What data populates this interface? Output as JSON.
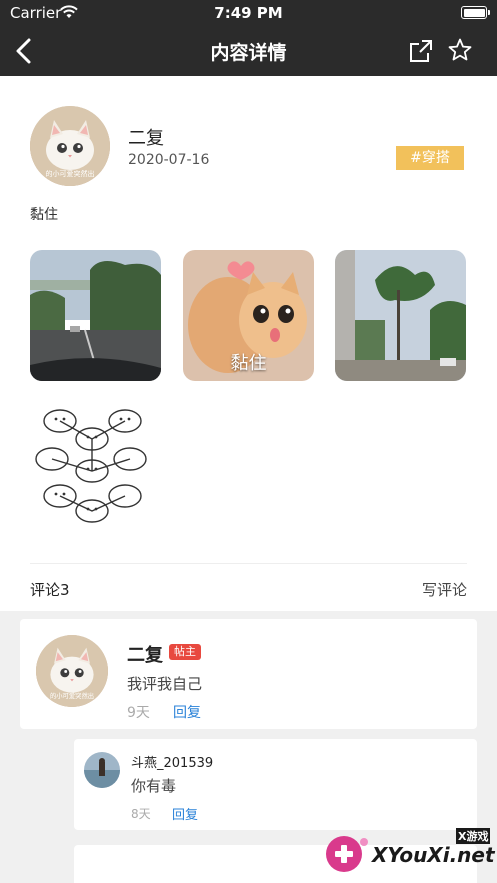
{
  "status_bar": {
    "carrier": "Carrier",
    "time": "7:49 PM"
  },
  "nav": {
    "title": "内容详情"
  },
  "post": {
    "author_name": "二复",
    "date": "2020-07-16",
    "tag": "#穿搭",
    "text": "黏住",
    "avatar_caption": "的小可爱突然出",
    "photos": [
      {
        "name": "street-photo",
        "caption": ""
      },
      {
        "name": "cats-photo",
        "caption": "黏住"
      },
      {
        "name": "trees-photo",
        "caption": ""
      },
      {
        "name": "sketch-photo",
        "caption": ""
      }
    ]
  },
  "comments_header": {
    "count_label": "评论3",
    "write_label": "写评论"
  },
  "comment": {
    "author": "二复",
    "badge": "帖主",
    "text": "我评我自己",
    "time": "9天",
    "reply_label": "回复",
    "avatar_caption": "的小可爱突然出"
  },
  "reply": {
    "author": "斗燕_201539",
    "text": "你有毒",
    "time": "8天",
    "reply_label": "回复"
  },
  "watermark": {
    "small": "X游戏",
    "big": "XYouXi.net"
  },
  "colors": {
    "nav_bg": "#2b2b2b",
    "tag": "#f2c15b",
    "badge": "#e8493f",
    "link": "#2a82d8"
  }
}
